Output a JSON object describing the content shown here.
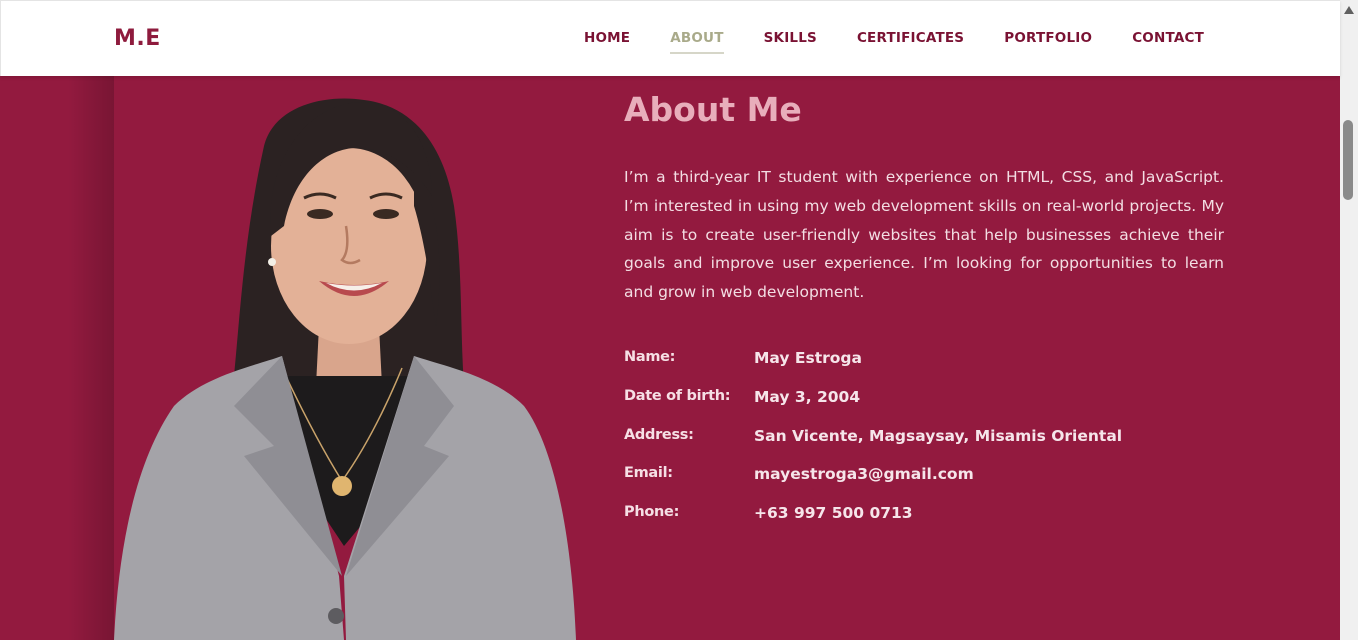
{
  "header": {
    "logo": "M.E",
    "nav": [
      "HOME",
      "ABOUT",
      "SKILLS",
      "CERTIFICATES",
      "PORTFOLIO",
      "CONTACT"
    ],
    "active": "ABOUT"
  },
  "about": {
    "title": "About Me",
    "bio": "I’m a third-year IT student with experience on HTML, CSS, and JavaScript. I’m interested in using my web development skills on real-world projects. My aim is to create user-friendly websites that help businesses achieve their goals and improve user experience. I’m looking for opportunities to learn and grow in web development.",
    "info": [
      {
        "label": "Name:",
        "value": "May Estroga"
      },
      {
        "label": "Date of birth:",
        "value": "May 3, 2004"
      },
      {
        "label": "Address:",
        "value": "San Vicente, Magsaysay, Misamis Oriental"
      },
      {
        "label": "Email:",
        "value": "mayestroga3@gmail.com"
      },
      {
        "label": "Phone:",
        "value": "+63 997 500 0713"
      }
    ]
  },
  "colors": {
    "primary": "#931a3f",
    "accent": "#a9aa8a",
    "nav_text": "#7a1233",
    "title": "#e8aebb"
  },
  "icons": [
    "profile-photo",
    "scroll-up-arrow"
  ]
}
